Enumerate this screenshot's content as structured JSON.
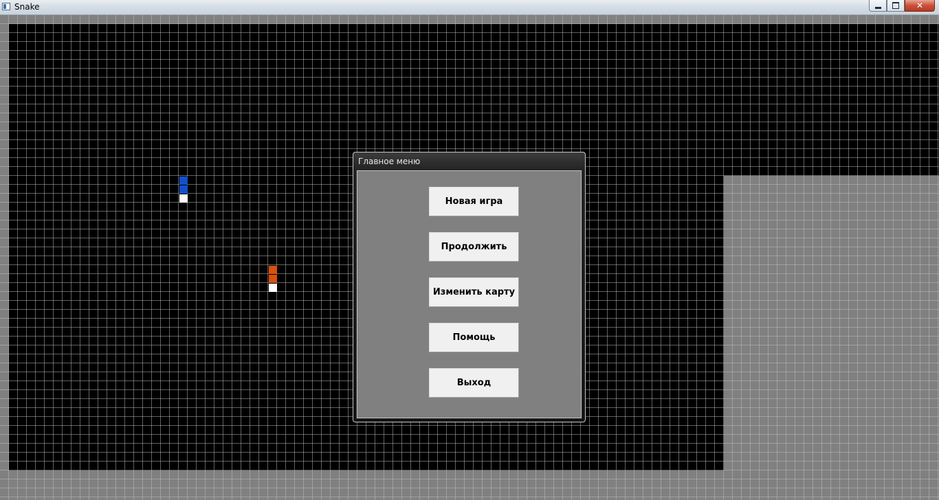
{
  "window": {
    "title": "Snake",
    "minimize_icon": "minimize-icon",
    "maximize_icon": "restore-icon",
    "close_icon": "close-icon"
  },
  "game": {
    "dark_field_color": "#000000",
    "wall_color": "#808080",
    "grid_line_color": "#c0c0c0",
    "snakes": [
      {
        "name": "blue",
        "color": "#1450c8"
      },
      {
        "name": "orange",
        "color": "#d8500f"
      }
    ]
  },
  "main_menu": {
    "title": "Главное меню",
    "buttons": [
      "Новая игра",
      "Продолжить",
      "Изменить карту",
      "Помощь",
      "Выход"
    ]
  }
}
